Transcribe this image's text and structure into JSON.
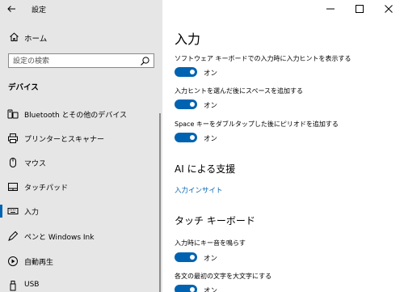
{
  "app": {
    "title": "設定"
  },
  "sidebar": {
    "home_label": "ホーム",
    "search": {
      "placeholder": "設定の検索"
    },
    "section_heading": "デバイス",
    "items": [
      {
        "label": "Bluetooth とその他のデバイス",
        "icon": "bluetooth-devices-icon"
      },
      {
        "label": "プリンターとスキャナー",
        "icon": "printer-icon"
      },
      {
        "label": "マウス",
        "icon": "mouse-icon"
      },
      {
        "label": "タッチパッド",
        "icon": "touchpad-icon"
      },
      {
        "label": "入力",
        "icon": "keyboard-icon",
        "selected": true
      },
      {
        "label": "ペンと Windows Ink",
        "icon": "pen-icon"
      },
      {
        "label": "自動再生",
        "icon": "autoplay-icon"
      },
      {
        "label": "USB",
        "icon": "usb-icon"
      }
    ]
  },
  "main": {
    "title": "入力",
    "settings": [
      {
        "label": "ソフトウェア キーボードでの入力時に入力ヒントを表示する",
        "state": "オン",
        "on": true
      },
      {
        "label": "入力ヒントを選んだ後にスペースを追加する",
        "state": "オン",
        "on": true
      },
      {
        "label": "Space キーをダブルタップした後にピリオドを追加する",
        "state": "オン",
        "on": true
      }
    ],
    "ai_section": {
      "heading": "AI による支援",
      "link": "入力インサイト"
    },
    "touch_section": {
      "heading": "タッチ キーボード",
      "settings": [
        {
          "label": "入力時にキー音を鳴らす",
          "state": "オン",
          "on": true
        },
        {
          "label": "各文の最初の文字を大文字にする",
          "state": "オン",
          "on": true
        }
      ]
    }
  },
  "colors": {
    "accent": "#0063b1",
    "sidebar_bg": "#e6e6e6",
    "main_bg": "#ffffff"
  }
}
